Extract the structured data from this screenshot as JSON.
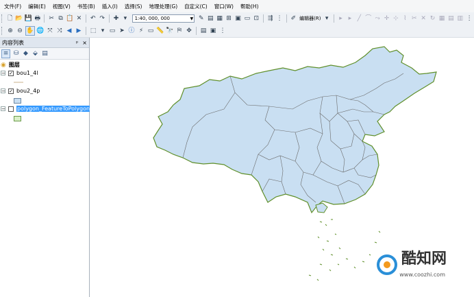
{
  "menu": [
    "文件(F)",
    "编辑(E)",
    "视图(V)",
    "书签(B)",
    "插入(I)",
    "选择(S)",
    "地理处理(G)",
    "自定义(C)",
    "窗口(W)",
    "帮助(H)"
  ],
  "toolbar": {
    "scale_value": "1:40, 000, 000",
    "editor_label": "编辑器(R)"
  },
  "toc": {
    "title": "内容列表",
    "pin_glyph": "ᵖ",
    "close_glyph": "×",
    "group_label": "图层",
    "layers": [
      {
        "name": "bou1_4l",
        "checked": true
      },
      {
        "name": "bou2_4p",
        "checked": true
      },
      {
        "name": "polygon_FeatureToPolygon",
        "checked": false
      }
    ]
  },
  "map": {
    "fill_color": "#c9dff2",
    "outline_color": "#5f8f2a",
    "border_color": "#6a6a6a"
  },
  "watermark": {
    "brand": "酷知网",
    "url": "www.coozhi.com"
  }
}
